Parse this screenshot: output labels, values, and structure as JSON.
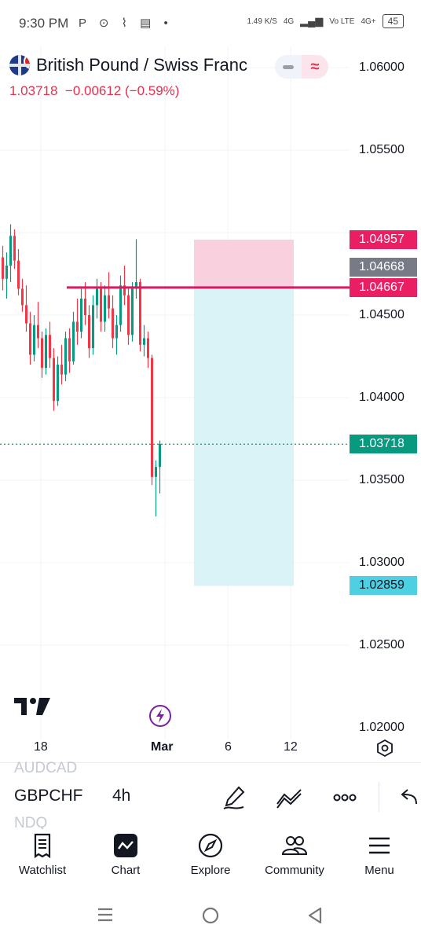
{
  "status_bar": {
    "time": "9:30 PM",
    "indicators": "P ⊙ ⌇ ▤ •",
    "speed": "1.49 K/S",
    "network": "4G",
    "volte": "Vo LTE",
    "network2": "4G+",
    "battery": "45"
  },
  "header": {
    "symbol_name": "British Pound / Swiss Franc",
    "price": "1.03718",
    "change": "−0.00612 (−0.59%)"
  },
  "price_scale": {
    "labels": [
      "1.06000",
      "1.05500",
      "1.04500",
      "1.04000",
      "1.03500",
      "1.03000",
      "1.02500",
      "1.02000"
    ],
    "tags": {
      "stop": "1.04957",
      "gray": "1.04668",
      "entry": "1.04667",
      "current": "1.03718",
      "target": "1.02859"
    }
  },
  "time_axis": {
    "ticks": [
      "18",
      "Mar",
      "6",
      "12"
    ]
  },
  "symbol_bar": {
    "ghost_above": "AUDCAD",
    "ticker": "GBPCHF",
    "interval": "4h",
    "ghost_below": "NDQ"
  },
  "bottom_nav": {
    "items": [
      {
        "label": "Watchlist",
        "icon": "watchlist-icon"
      },
      {
        "label": "Chart",
        "icon": "chart-icon"
      },
      {
        "label": "Explore",
        "icon": "explore-icon"
      },
      {
        "label": "Community",
        "icon": "community-icon"
      },
      {
        "label": "Menu",
        "icon": "menu-icon"
      }
    ]
  },
  "colors": {
    "up": "#089981",
    "down": "#f23645",
    "stop_zone": "#f8c8d8",
    "target_zone": "#d3f1f5",
    "entry_line": "#d81b60",
    "current_tag": "#089981",
    "target_tag": "#4dd0e1"
  },
  "chart_data": {
    "type": "candlestick",
    "symbol": "GBPCHF",
    "interval": "4h",
    "ylim": [
      1.02,
      1.061
    ],
    "last_price": 1.03718,
    "position": {
      "entry": 1.04667,
      "stop": 1.04957,
      "target": 1.02859
    },
    "candles": [
      [
        1.0485,
        1.0492,
        1.0465,
        1.0472
      ],
      [
        1.0472,
        1.0488,
        1.046,
        1.048
      ],
      [
        1.048,
        1.0505,
        1.047,
        1.0498
      ],
      [
        1.0498,
        1.0502,
        1.0478,
        1.0483
      ],
      [
        1.0483,
        1.049,
        1.0462,
        1.0466
      ],
      [
        1.0466,
        1.0472,
        1.0452,
        1.0456
      ],
      [
        1.0456,
        1.0468,
        1.044,
        1.0445
      ],
      [
        1.0445,
        1.0452,
        1.042,
        1.0426
      ],
      [
        1.0426,
        1.045,
        1.0422,
        1.0444
      ],
      [
        1.0444,
        1.0458,
        1.043,
        1.0436
      ],
      [
        1.0436,
        1.044,
        1.0412,
        1.0418
      ],
      [
        1.0418,
        1.0442,
        1.0414,
        1.0438
      ],
      [
        1.0438,
        1.0446,
        1.0418,
        1.0424
      ],
      [
        1.0424,
        1.043,
        1.0392,
        1.0398
      ],
      [
        1.0398,
        1.0425,
        1.0395,
        1.042
      ],
      [
        1.042,
        1.0432,
        1.0408,
        1.0414
      ],
      [
        1.0414,
        1.044,
        1.041,
        1.0436
      ],
      [
        1.0436,
        1.0442,
        1.0415,
        1.0422
      ],
      [
        1.0422,
        1.0452,
        1.042,
        1.0446
      ],
      [
        1.0446,
        1.046,
        1.0432,
        1.044
      ],
      [
        1.044,
        1.0466,
        1.0436,
        1.046
      ],
      [
        1.046,
        1.047,
        1.0444,
        1.045
      ],
      [
        1.045,
        1.0456,
        1.0424,
        1.043
      ],
      [
        1.043,
        1.0462,
        1.0426,
        1.0456
      ],
      [
        1.0456,
        1.0472,
        1.0448,
        1.0466
      ],
      [
        1.0466,
        1.047,
        1.044,
        1.0446
      ],
      [
        1.0446,
        1.0468,
        1.044,
        1.0462
      ],
      [
        1.0462,
        1.0476,
        1.0448,
        1.0454
      ],
      [
        1.0454,
        1.0462,
        1.043,
        1.0436
      ],
      [
        1.0436,
        1.045,
        1.0426,
        1.0444
      ],
      [
        1.0444,
        1.0474,
        1.044,
        1.0468
      ],
      [
        1.0468,
        1.048,
        1.0456,
        1.0462
      ],
      [
        1.0462,
        1.0466,
        1.0432,
        1.0438
      ],
      [
        1.0438,
        1.047,
        1.0434,
        1.0466
      ],
      [
        1.0466,
        1.0496,
        1.046,
        1.047
      ],
      [
        1.047,
        1.0472,
        1.0428,
        1.0432
      ],
      [
        1.0432,
        1.0444,
        1.0425,
        1.0436
      ],
      [
        1.0436,
        1.044,
        1.0418,
        1.0424
      ],
      [
        1.0424,
        1.0426,
        1.0347,
        1.0352
      ],
      [
        1.0352,
        1.0362,
        1.0328,
        1.0358
      ],
      [
        1.0358,
        1.0374,
        1.0342,
        1.0372
      ]
    ]
  }
}
